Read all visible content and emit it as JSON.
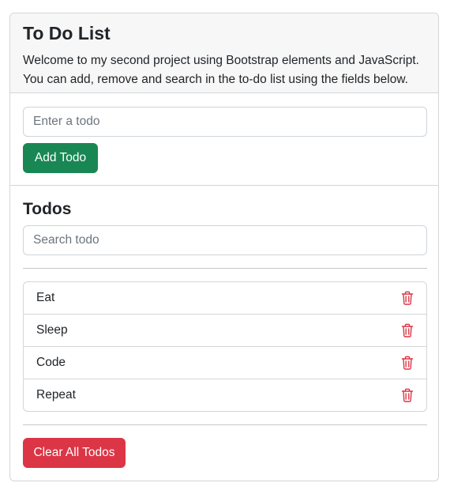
{
  "header": {
    "title": "To Do List",
    "description_line1": "Welcome to my second project using Bootstrap elements and JavaScript.",
    "description_line2": "You can add, remove and search in the to-do list using the fields below."
  },
  "add": {
    "placeholder": "Enter a todo",
    "value": "",
    "button_label": "Add Todo"
  },
  "todos": {
    "heading": "Todos",
    "search_placeholder": "Search todo",
    "items": [
      {
        "label": "Eat",
        "icon": "trash-icon"
      },
      {
        "label": "Sleep",
        "icon": "trash-icon"
      },
      {
        "label": "Code",
        "icon": "trash-icon"
      },
      {
        "label": "Repeat",
        "icon": "trash-icon"
      }
    ],
    "clear_label": "Clear All Todos"
  },
  "colors": {
    "success": "#198754",
    "danger": "#dc3545",
    "header_bg": "#f7f7f7"
  }
}
